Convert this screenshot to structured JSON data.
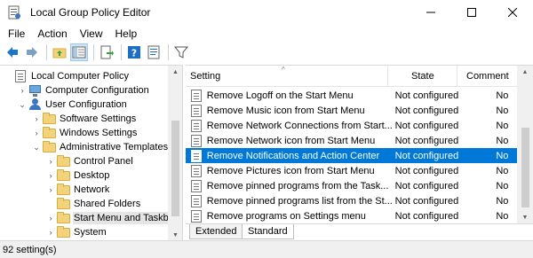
{
  "window": {
    "title": "Local Group Policy Editor",
    "minimize_glyph": "—",
    "maximize_glyph": "☐",
    "close_glyph": "✕"
  },
  "menu": [
    "File",
    "Action",
    "View",
    "Help"
  ],
  "toolbar": {
    "buttons": [
      "back-icon",
      "forward-icon",
      "up-folder-icon",
      "show-hide-tree-icon",
      "export-list-icon",
      "help-icon",
      "properties-icon",
      "filter-icon"
    ]
  },
  "tree": {
    "items": [
      {
        "label": "Local Computer Policy",
        "icon": "policy",
        "level": 0,
        "expander": ""
      },
      {
        "label": "Computer Configuration",
        "icon": "pc",
        "level": 1,
        "expander": "›"
      },
      {
        "label": "User Configuration",
        "icon": "user",
        "level": 1,
        "expander": "⌄"
      },
      {
        "label": "Software Settings",
        "icon": "folder",
        "level": 2,
        "expander": "›"
      },
      {
        "label": "Windows Settings",
        "icon": "folder",
        "level": 2,
        "expander": "›"
      },
      {
        "label": "Administrative Templates",
        "icon": "folder",
        "level": 2,
        "expander": "⌄"
      },
      {
        "label": "Control Panel",
        "icon": "folder",
        "level": 3,
        "expander": "›"
      },
      {
        "label": "Desktop",
        "icon": "folder",
        "level": 3,
        "expander": "›"
      },
      {
        "label": "Network",
        "icon": "folder",
        "level": 3,
        "expander": "›"
      },
      {
        "label": "Shared Folders",
        "icon": "folder",
        "level": 3,
        "expander": ""
      },
      {
        "label": "Start Menu and Taskbar",
        "icon": "folder",
        "level": 3,
        "expander": "›",
        "selected": true
      },
      {
        "label": "System",
        "icon": "folder",
        "level": 3,
        "expander": "›"
      }
    ]
  },
  "list": {
    "columns": {
      "setting": "Setting",
      "state": "State",
      "comment": "Comment"
    },
    "rows": [
      {
        "name": "Remove Logoff on the Start Menu",
        "state": "Not configured",
        "comment": "No"
      },
      {
        "name": "Remove Music icon from Start Menu",
        "state": "Not configured",
        "comment": "No"
      },
      {
        "name": "Remove Network Connections from Start...",
        "state": "Not configured",
        "comment": "No"
      },
      {
        "name": "Remove Network icon from Start Menu",
        "state": "Not configured",
        "comment": "No"
      },
      {
        "name": "Remove Notifications and Action Center",
        "state": "Not configured",
        "comment": "No",
        "selected": true
      },
      {
        "name": "Remove Pictures icon from Start Menu",
        "state": "Not configured",
        "comment": "No"
      },
      {
        "name": "Remove pinned programs from the Task...",
        "state": "Not configured",
        "comment": "No"
      },
      {
        "name": "Remove pinned programs list from the St...",
        "state": "Not configured",
        "comment": "No"
      },
      {
        "name": "Remove programs on Settings menu",
        "state": "Not configured",
        "comment": "No"
      }
    ]
  },
  "tabs": [
    "Extended",
    "Standard"
  ],
  "status": {
    "text": "92 setting(s)"
  },
  "colors": {
    "selection": "#0078d7",
    "folder": "#f4d27c"
  }
}
